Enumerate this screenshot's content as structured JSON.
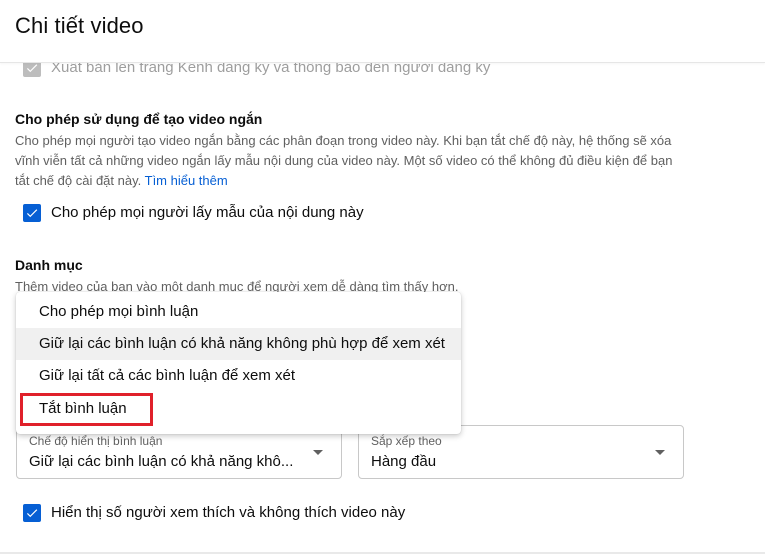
{
  "header": {
    "title": "Chi tiết video"
  },
  "publish_option": {
    "label": "Xuất bản lên trang Kênh đăng ký và thông báo đến người đăng ký",
    "checked": true
  },
  "shorts_section": {
    "title": "Cho phép sử dụng để tạo video ngắn",
    "description": "Cho phép mọi người tạo video ngắn bằng các phân đoạn trong video này. Khi bạn tắt chế độ này, hệ thống sẽ xóa vĩnh viễn tất cả những video ngắn lấy mẫu nội dung của video này. Một số video có thể không đủ điều kiện để bạn tắt chế độ cài đặt này.",
    "link": "Tìm hiểu thêm",
    "checkbox_label": "Cho phép mọi người lấy mẫu của nội dung này",
    "checked": true
  },
  "category_section": {
    "title": "Danh mục",
    "description": "Thêm video của bạn vào một danh mục để người xem dễ dàng tìm thấy hơn."
  },
  "comment_dropdown": {
    "items": [
      "Cho phép mọi bình luận",
      "Giữ lại các bình luận có khả năng không phù hợp để xem xét",
      "Giữ lại tất cả các bình luận để xem xét",
      "Tắt bình luận"
    ],
    "hovered_index": 1
  },
  "comment_display": {
    "label": "Chế độ hiển thị bình luận",
    "value": "Giữ lại các bình luận có khả năng khô..."
  },
  "sort_by": {
    "label": "Sắp xếp theo",
    "value": "Hàng đầu"
  },
  "likes_option": {
    "label": "Hiển thị số người xem thích và không thích video này",
    "checked": true
  },
  "colors": {
    "accent": "#065fd4",
    "highlight": "#e0202a"
  }
}
